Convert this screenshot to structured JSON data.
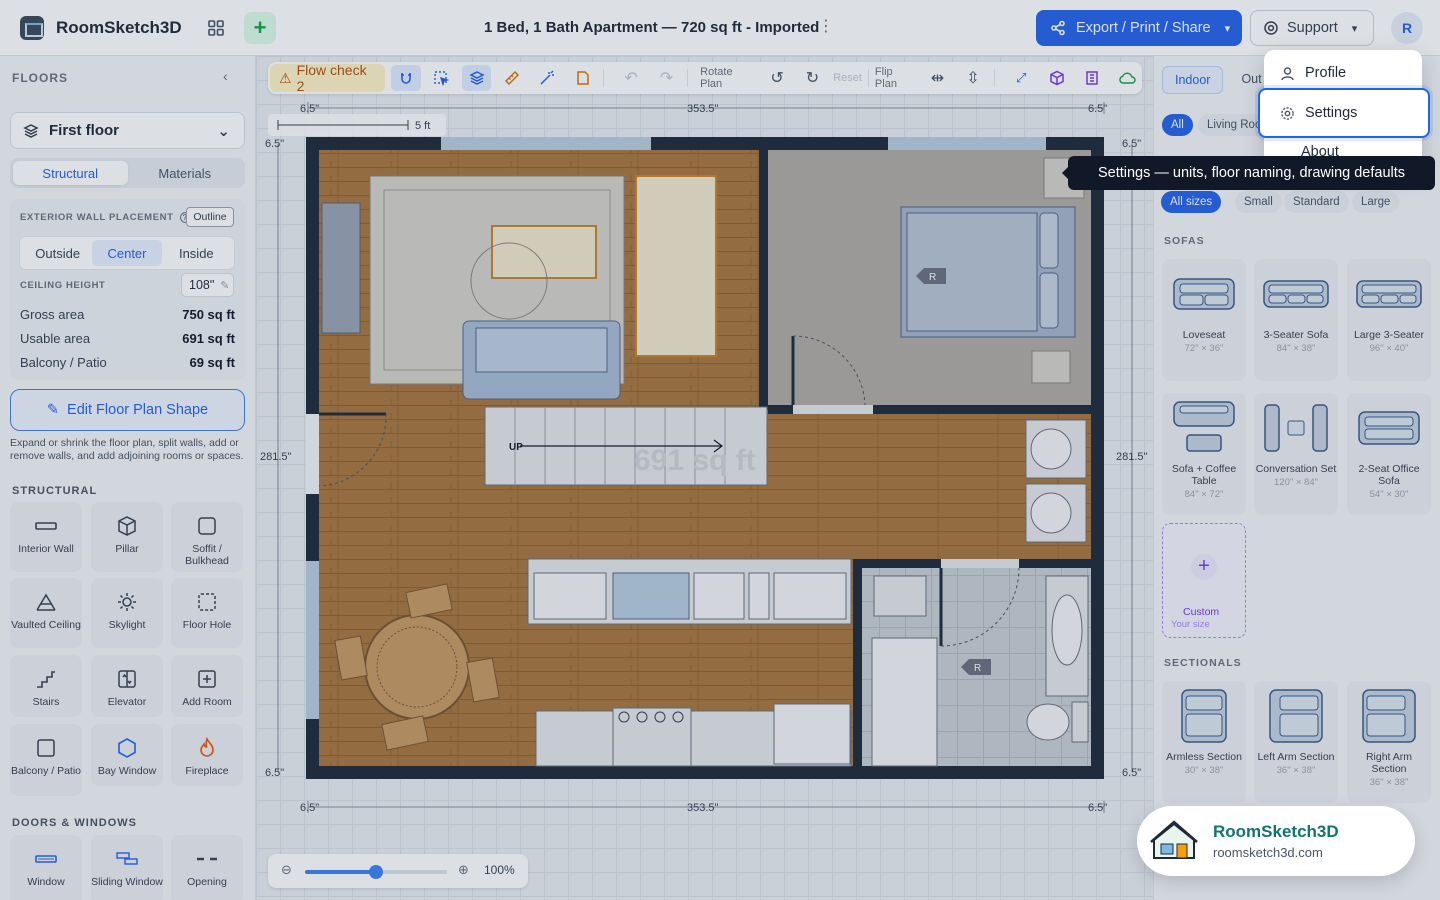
{
  "app": {
    "name": "RoomSketch3D",
    "doc_title": "1 Bed, 1 Bath Apartment — 720 sq ft - Imported"
  },
  "header": {
    "export_label": "Export / Print / Share",
    "support_label": "Support",
    "avatar_initial": "R"
  },
  "sidebar": {
    "title": "FLOORS",
    "floor": "First floor",
    "tabs": [
      "Structural",
      "Materials"
    ],
    "wall_placement_label": "EXTERIOR WALL PLACEMENT",
    "outline_label": "Outline",
    "placement_options": [
      "Outside",
      "Center",
      "Inside"
    ],
    "ceiling_label": "CEILING HEIGHT",
    "ceiling_value": "108\"",
    "stats": [
      {
        "label": "Gross area",
        "value": "750 sq ft"
      },
      {
        "label": "Usable area",
        "value": "691 sq ft"
      },
      {
        "label": "Balcony / Patio",
        "value": "69 sq ft"
      }
    ],
    "edit_button": "Edit Floor Plan Shape",
    "edit_desc": "Expand or shrink the floor plan, split walls, add or remove walls, and add adjoining rooms or spaces.",
    "structural_label": "STRUCTURAL",
    "structural_items": [
      "Interior Wall",
      "Pillar",
      "Soffit / Bulkhead",
      "Vaulted Ceiling",
      "Skylight",
      "Floor Hole",
      "Stairs",
      "Elevator",
      "Add Room",
      "Balcony / Patio",
      "Bay Window",
      "Fireplace"
    ],
    "doors_label": "DOORS & WINDOWS",
    "door_items": [
      "Window",
      "Sliding Window",
      "Opening"
    ]
  },
  "toolbar": {
    "flow_check": "Flow check 2",
    "rotate_label": "Rotate Plan",
    "reset_label": "Reset",
    "flip_label": "Flip Plan"
  },
  "plan": {
    "scale_label": "5 ft",
    "dims": {
      "top_left": "6.5\"",
      "top_mid": "353.5\"",
      "top_right": "6.5\"",
      "side": "281.5\"",
      "corner": "6.5\""
    },
    "stairs_label": "UP",
    "watermark": "691 sq ft",
    "marker": "R"
  },
  "zoom": {
    "value": "100%",
    "level": 0.5
  },
  "right_panel": {
    "tabs": [
      "Indoor",
      "Out"
    ],
    "room_chips": [
      "All",
      "Living Room"
    ],
    "size_chips": [
      "All sizes",
      "Small",
      "Standard",
      "Large"
    ],
    "sofas_label": "SOFAS",
    "sofas": [
      {
        "name": "Loveseat",
        "dim": "72\" × 36\""
      },
      {
        "name": "3-Seater Sofa",
        "dim": "84\" × 38\""
      },
      {
        "name": "Large 3-Seater",
        "dim": "96\" × 40\""
      },
      {
        "name": "Sofa + Coffee Table",
        "dim": "84\" × 72\""
      },
      {
        "name": "Conversation Set",
        "dim": "120\" × 84\""
      },
      {
        "name": "2-Seat Office Sofa",
        "dim": "54\" × 30\""
      }
    ],
    "custom_label": "Custom",
    "custom_sub": "Your size",
    "sectionals_label": "SECTIONALS",
    "sectionals": [
      {
        "name": "Armless Section",
        "dim": "30\" × 38\""
      },
      {
        "name": "Left Arm Section",
        "dim": "36\" × 38\""
      },
      {
        "name": "Right Arm Section",
        "dim": "36\" × 38\""
      }
    ]
  },
  "menu": {
    "items": [
      "Profile",
      "Settings",
      "About"
    ]
  },
  "tooltip": "Settings — units, floor naming, drawing defaults",
  "toast": {
    "title": "RoomSketch3D",
    "url": "roomsketch3d.com"
  },
  "colors": {
    "accent": "#2563eb",
    "wall": "#1e2a3b",
    "wood": "#a9773f",
    "tile": "#c7ccd3",
    "bedroom": "#b1aca6"
  }
}
